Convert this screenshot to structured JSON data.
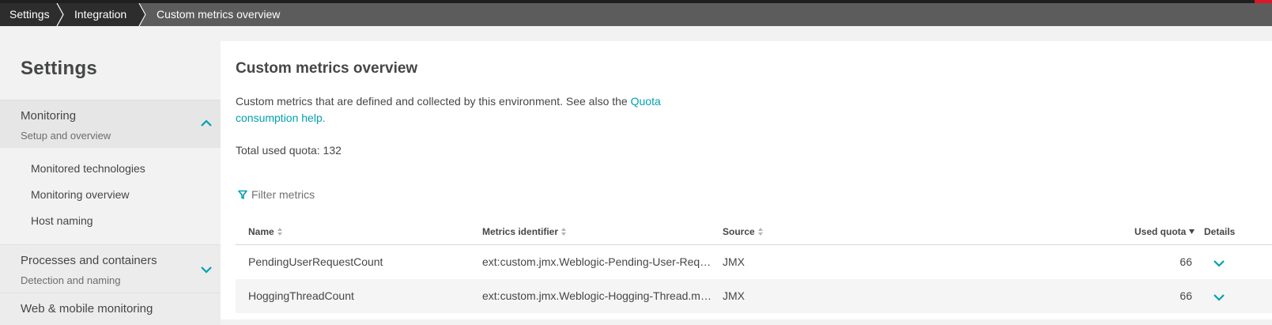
{
  "colors": {
    "accent": "#00a1b2",
    "breadcrumb_bg": "#5c5c5c",
    "breadcrumb_item_bg": "#2d2d2d",
    "brand_red": "#dc172a"
  },
  "breadcrumb": {
    "items": [
      "Settings",
      "Integration"
    ],
    "current": "Custom metrics overview"
  },
  "sidebar": {
    "title": "Settings",
    "sections": [
      {
        "title": "Monitoring",
        "subtitle": "Setup and overview",
        "expanded": true,
        "icon": "chevron-up-icon"
      },
      {
        "title": "Processes and containers",
        "subtitle": "Detection and naming",
        "expanded": false,
        "icon": "chevron-down-icon"
      },
      {
        "title": "Web & mobile monitoring"
      }
    ],
    "items": [
      "Monitored technologies",
      "Monitoring overview",
      "Host naming"
    ]
  },
  "main": {
    "title": "Custom metrics overview",
    "description": "Custom metrics that are defined and collected by this environment. See also the",
    "description_link": "Quota consumption help.",
    "quota_label": "Total used quota:",
    "quota_value": "132",
    "filter_placeholder": "Filter metrics",
    "filter_icon": "filter-icon",
    "table": {
      "columns": [
        "Name",
        "Metrics identifier",
        "Source",
        "Used quota",
        "Details"
      ],
      "rows": [
        {
          "name": "PendingUserRequestCount",
          "identifier": "ext:custom.jmx.Weblogic-Pending-User-Requ...",
          "source": "JMX",
          "quota": "66"
        },
        {
          "name": "HoggingThreadCount",
          "identifier": "ext:custom.jmx.Weblogic-Hogging-Thread.me...",
          "source": "JMX",
          "quota": "66"
        }
      ]
    }
  }
}
